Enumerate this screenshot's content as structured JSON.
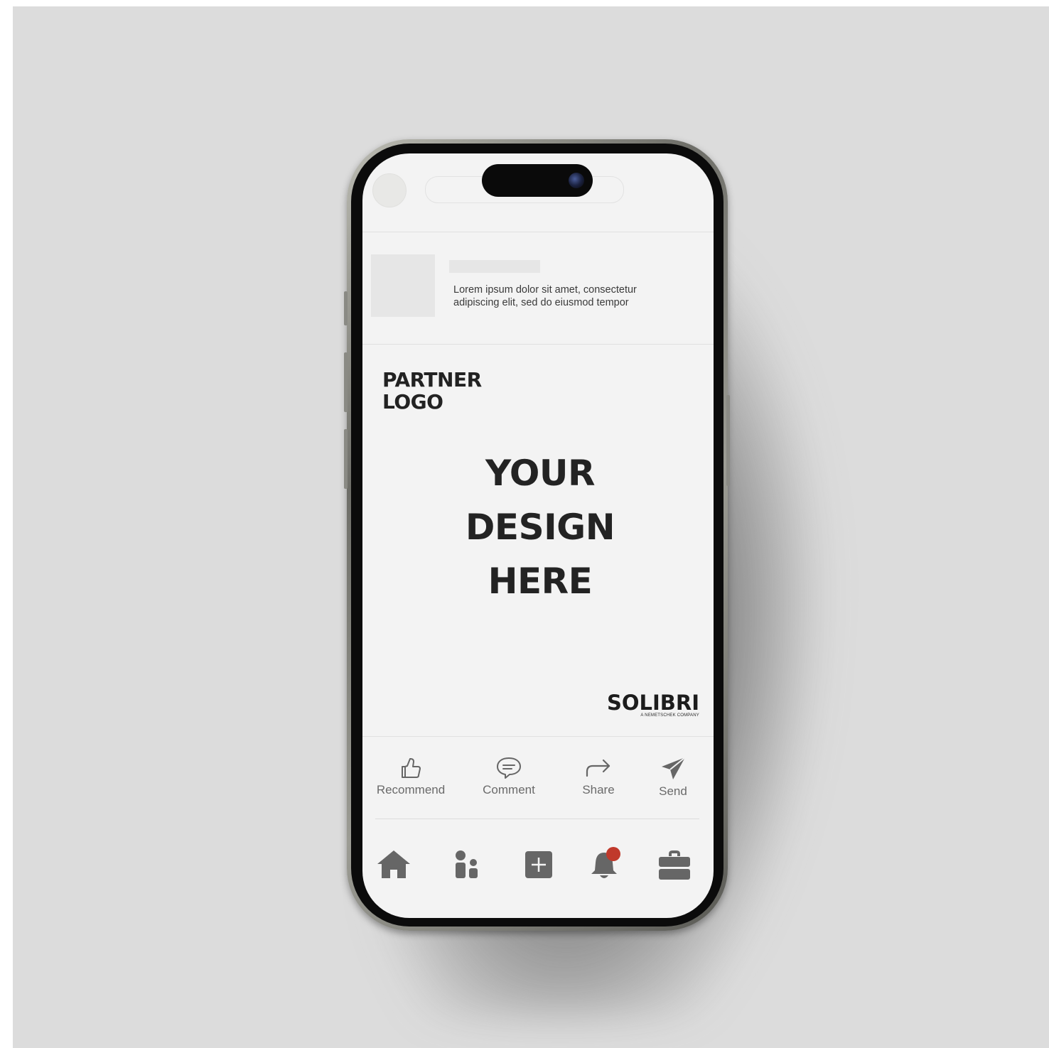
{
  "post": {
    "text_line1": "Lorem ipsum dolor sit amet, consectetur",
    "text_line2": "adipiscing elit, sed do eiusmod tempor"
  },
  "ad": {
    "partner_line1": "PARTNER",
    "partner_line2": "LOGO",
    "headline_line1": "YOUR",
    "headline_line2": "DESIGN",
    "headline_line3": "HERE",
    "brand_name": "SOLIBRI",
    "brand_tagline": "A NEMETSCHEK COMPANY"
  },
  "actions": [
    {
      "label": "Recommend",
      "icon": "thumbs-up-icon"
    },
    {
      "label": "Comment",
      "icon": "comment-icon"
    },
    {
      "label": "Share",
      "icon": "share-icon"
    },
    {
      "label": "Send",
      "icon": "send-icon"
    }
  ],
  "nav": [
    {
      "name": "home",
      "icon": "home-icon"
    },
    {
      "name": "network",
      "icon": "people-icon"
    },
    {
      "name": "post",
      "icon": "plus-box-icon"
    },
    {
      "name": "notifications",
      "icon": "bell-icon",
      "has_badge": true
    },
    {
      "name": "jobs",
      "icon": "briefcase-icon"
    }
  ],
  "colors": {
    "badge": "#c0392b",
    "icon": "#666666",
    "screen_background": "#f3f3f3",
    "page_background": "#dcdcdc"
  }
}
